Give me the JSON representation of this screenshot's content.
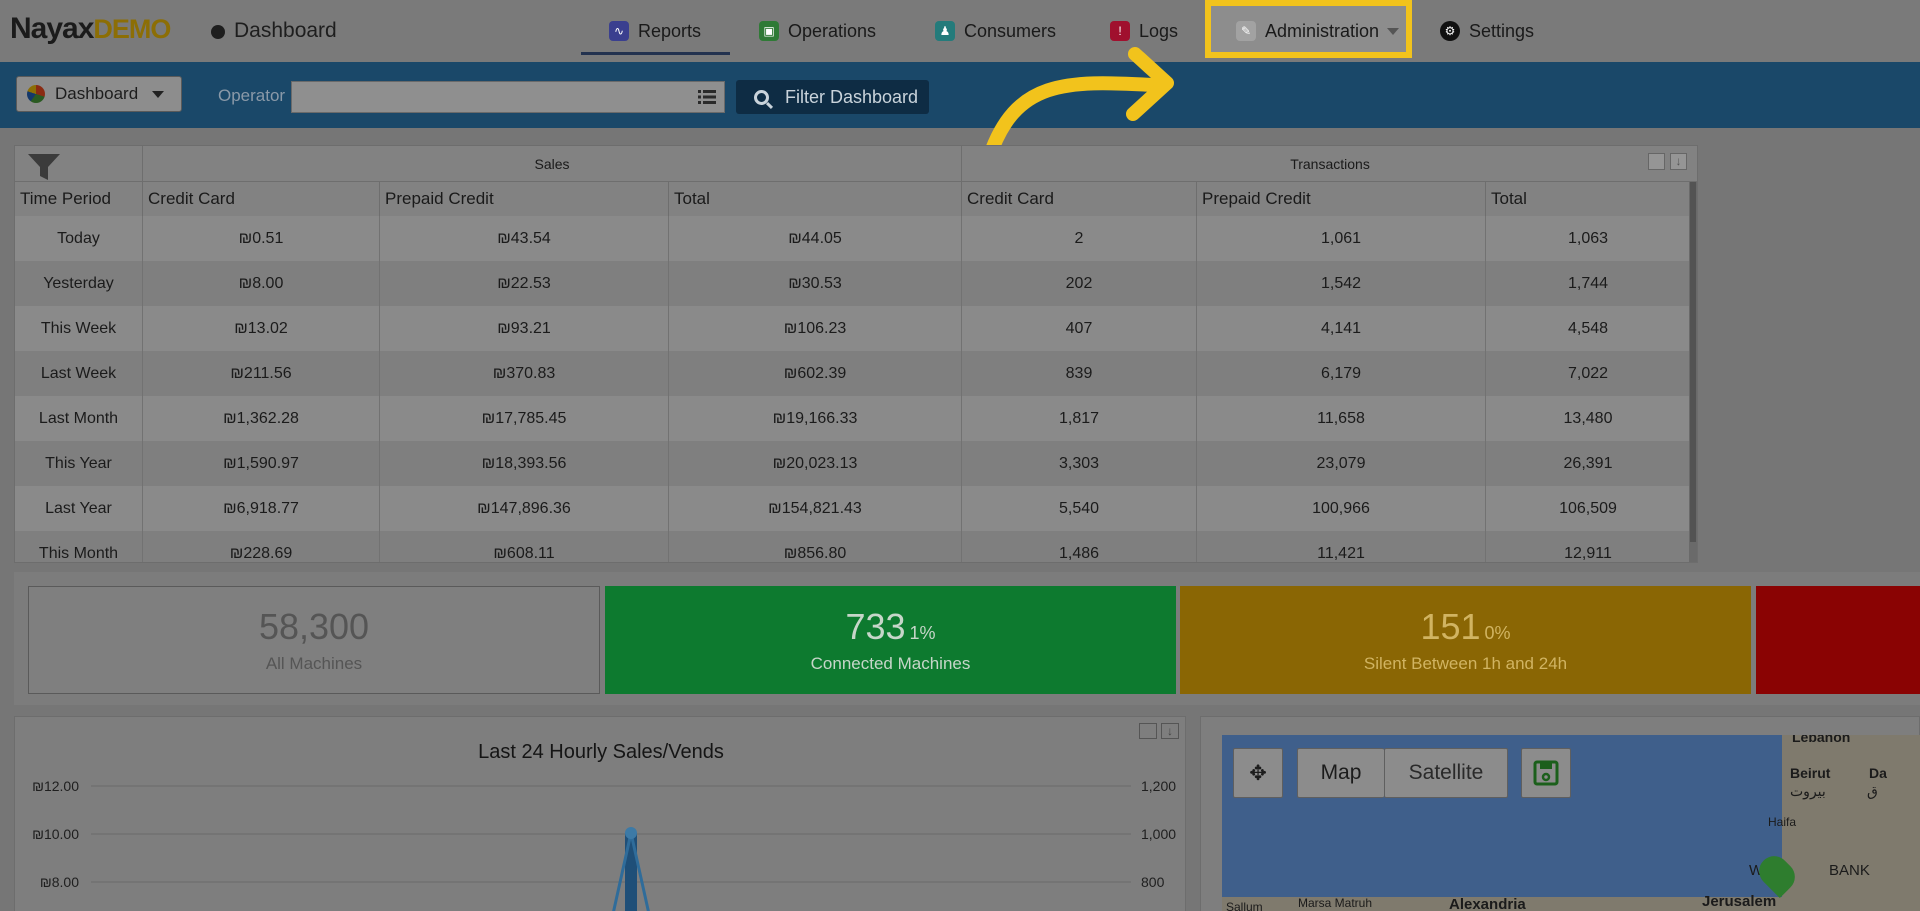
{
  "brand": {
    "logo_main": "Nayax",
    "logo_demo": "DEMO"
  },
  "breadcrumb": "Dashboard",
  "nav": {
    "tabs": [
      {
        "label": "Reports",
        "icon": "reports-icon",
        "color": "#3a3f8f"
      },
      {
        "label": "Operations",
        "icon": "operations-icon",
        "color": "#3a8a3a"
      },
      {
        "label": "Consumers",
        "icon": "consumers-icon",
        "color": "#2a8a8a"
      },
      {
        "label": "Logs",
        "icon": "logs-icon",
        "color": "#c0143c"
      },
      {
        "label": "Administration",
        "icon": "administration-icon",
        "color": "#888888"
      },
      {
        "label": "Settings",
        "icon": "settings-icon",
        "color": "#222222"
      }
    ]
  },
  "toolbar": {
    "dashboard_label": "Dashboard",
    "operator_label": "Operator",
    "operator_value": "",
    "filter_label": "Filter Dashboard"
  },
  "table": {
    "groups": [
      "Sales",
      "Transactions"
    ],
    "columns": [
      "Time Period",
      "Credit Card",
      "Prepaid Credit",
      "Total",
      "Credit Card",
      "Prepaid Credit",
      "Total"
    ],
    "rows": [
      [
        "Today",
        "₪0.51",
        "₪43.54",
        "₪44.05",
        "2",
        "1,061",
        "1,063"
      ],
      [
        "Yesterday",
        "₪8.00",
        "₪22.53",
        "₪30.53",
        "202",
        "1,542",
        "1,744"
      ],
      [
        "This Week",
        "₪13.02",
        "₪93.21",
        "₪106.23",
        "407",
        "4,141",
        "4,548"
      ],
      [
        "Last Week",
        "₪211.56",
        "₪370.83",
        "₪602.39",
        "839",
        "6,179",
        "7,022"
      ],
      [
        "Last Month",
        "₪1,362.28",
        "₪17,785.45",
        "₪19,166.33",
        "1,817",
        "11,658",
        "13,480"
      ],
      [
        "This Year",
        "₪1,590.97",
        "₪18,393.56",
        "₪20,023.13",
        "3,303",
        "23,079",
        "26,391"
      ],
      [
        "Last Year",
        "₪6,918.77",
        "₪147,896.36",
        "₪154,821.43",
        "5,540",
        "100,966",
        "106,509"
      ],
      [
        "This Month",
        "₪228.69",
        "₪608.11",
        "₪856.80",
        "1,486",
        "11,421",
        "12,911"
      ]
    ]
  },
  "stats": [
    {
      "value": "58,300",
      "pct": "",
      "label": "All Machines",
      "bg": "#7f7f7f",
      "fg": "#555555"
    },
    {
      "value": "733",
      "pct": "1%",
      "label": "Connected Machines",
      "bg": "#0d7a2f",
      "fg": "#c6d6c9"
    },
    {
      "value": "151",
      "pct": "0%",
      "label": "Silent Between 1h and 24h",
      "bg": "#8a6604",
      "fg": "#d1b462"
    },
    {
      "value": "",
      "pct": "",
      "label": "",
      "bg": "#8a0303",
      "fg": "#d0d0d0"
    }
  ],
  "chart_data": {
    "type": "line",
    "title": "Last 24 Hourly Sales/Vends",
    "left_ticks": [
      "₪12.00",
      "₪10.00",
      "₪8.00"
    ],
    "right_ticks": [
      "1,200",
      "1,000",
      "800"
    ]
  },
  "map": {
    "map_label": "Map",
    "satellite_label": "Satellite",
    "places": [
      "Lebanon",
      "Beirut",
      "بيروت",
      "Da",
      "ق",
      "Haifa",
      "BANK",
      "W",
      "Sallum",
      "Marsa Matruh",
      "Alexandria",
      "Jerusalem"
    ]
  },
  "colors": {
    "highlight": "#f2c31c",
    "toolbar": "#1a4869"
  }
}
